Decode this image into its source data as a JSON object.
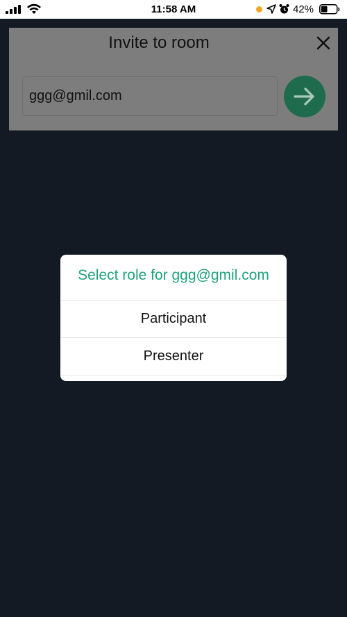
{
  "status_bar": {
    "time": "11:58 AM",
    "battery_percent": "42%",
    "battery_level": 0.42,
    "icons": [
      "cellular-signal-icon",
      "wifi-icon",
      "recording-indicator-icon",
      "location-arrow-icon",
      "alarm-clock-icon",
      "battery-icon"
    ],
    "indicator_color": "#f5a623"
  },
  "invite": {
    "title": "Invite to room",
    "email_value": "ggg@gmil.com",
    "close_icon": "close-icon",
    "send_icon": "arrow-right-icon"
  },
  "role_modal": {
    "title": "Select role for ggg@gmil.com",
    "options": [
      "Participant",
      "Presenter"
    ]
  },
  "colors": {
    "accent": "#1fa37c",
    "send_button": "#1f6b4e",
    "backdrop": "#131a24"
  }
}
